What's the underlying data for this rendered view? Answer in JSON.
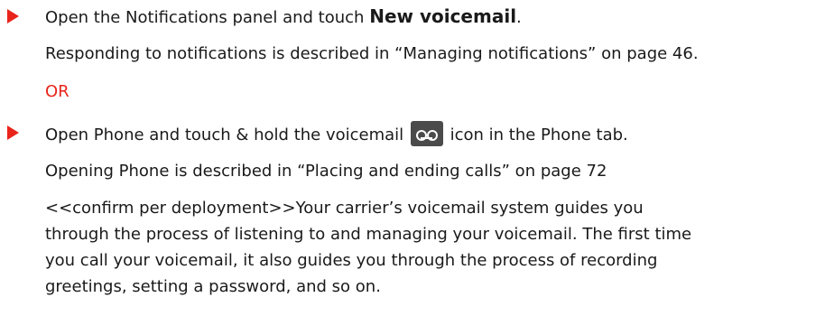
{
  "step1": {
    "text_before": "Open the Notifications panel and touch ",
    "bold": "New voicemail",
    "text_after": ".",
    "note": "Responding to notifications is described in “Managing notifications” on page 46."
  },
  "or_label": "OR",
  "step2": {
    "text_before": "Open Phone and touch & hold the voicemail ",
    "icon": "voicemail-icon",
    "text_after": " icon in the Phone tab.",
    "note": "Opening Phone is described in “Placing and ending calls” on page 72",
    "paragraph_lines": [
      "<<confirm per deployment>>Your carrier’s voicemail system guides you",
      "through the process of listening to and managing your voicemail. The first time",
      "you call your voicemail, it also guides you through the process of recording",
      "greetings, setting a password, and so on."
    ]
  },
  "colors": {
    "accent": "#e8241b",
    "text": "#1a1a1a",
    "icon_bg": "#4b4b4b"
  }
}
